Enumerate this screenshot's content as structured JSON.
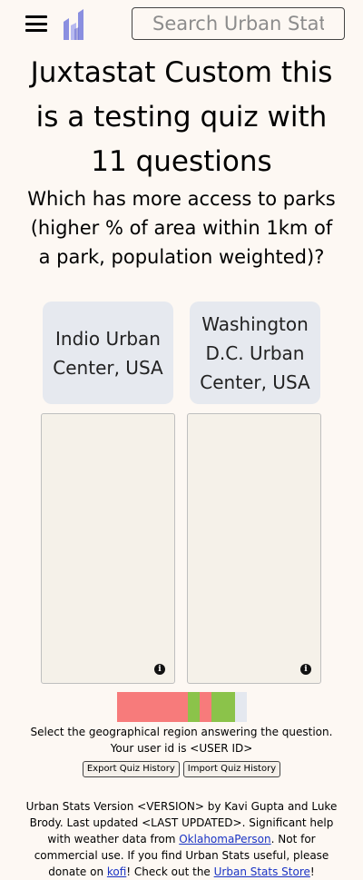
{
  "header": {
    "menu_icon": "hamburger-icon",
    "logo_icon": "urban-stats-logo-icon",
    "search_placeholder": "Search Urban Stats"
  },
  "quiz": {
    "title": "Juxtastat Custom this is a testing quiz with 11 questions",
    "question": "Which has more access to parks (higher % of area within 1km of a park, population weighted)?",
    "choices": [
      {
        "label": "Indio Urban Center, USA"
      },
      {
        "label": "Washington D.C. Urban Center, USA"
      }
    ],
    "info_icon": "info-icon",
    "progress": [
      {
        "result": "incorrect",
        "color": "#f77b7b"
      },
      {
        "result": "incorrect",
        "color": "#f77b7b"
      },
      {
        "result": "incorrect",
        "color": "#f77b7b"
      },
      {
        "result": "incorrect",
        "color": "#f77b7b"
      },
      {
        "result": "incorrect",
        "color": "#f77b7b"
      },
      {
        "result": "incorrect",
        "color": "#f77b7b"
      },
      {
        "result": "correct",
        "color": "#8bc34a"
      },
      {
        "result": "incorrect",
        "color": "#f77b7b"
      },
      {
        "result": "correct",
        "color": "#8bc34a"
      },
      {
        "result": "correct",
        "color": "#8bc34a"
      },
      {
        "result": "pending",
        "color": "#e4e8ef"
      }
    ],
    "instruction": "Select the geographical region answering the question.",
    "user_id_text": "Your user id is <USER ID>",
    "export_label": "Export Quiz History",
    "import_label": "Import Quiz History"
  },
  "footer": {
    "text1": "Urban Stats Version <VERSION> by Kavi Gupta and Luke Brody. Last updated <LAST UPDATED>. Significant help with weather data from ",
    "link1": "OklahomaPerson",
    "text2": ". Not for commercial use. If you find Urban Stats useful, please donate on ",
    "link2": "kofi",
    "text3": "! Check out the ",
    "link3": "Urban Stats Store",
    "text4": "!"
  },
  "colors": {
    "background": "#fdf8f3",
    "choice_bg": "#e6e9ef",
    "link": "#1a33c4",
    "logo": "#8a8fe0"
  }
}
